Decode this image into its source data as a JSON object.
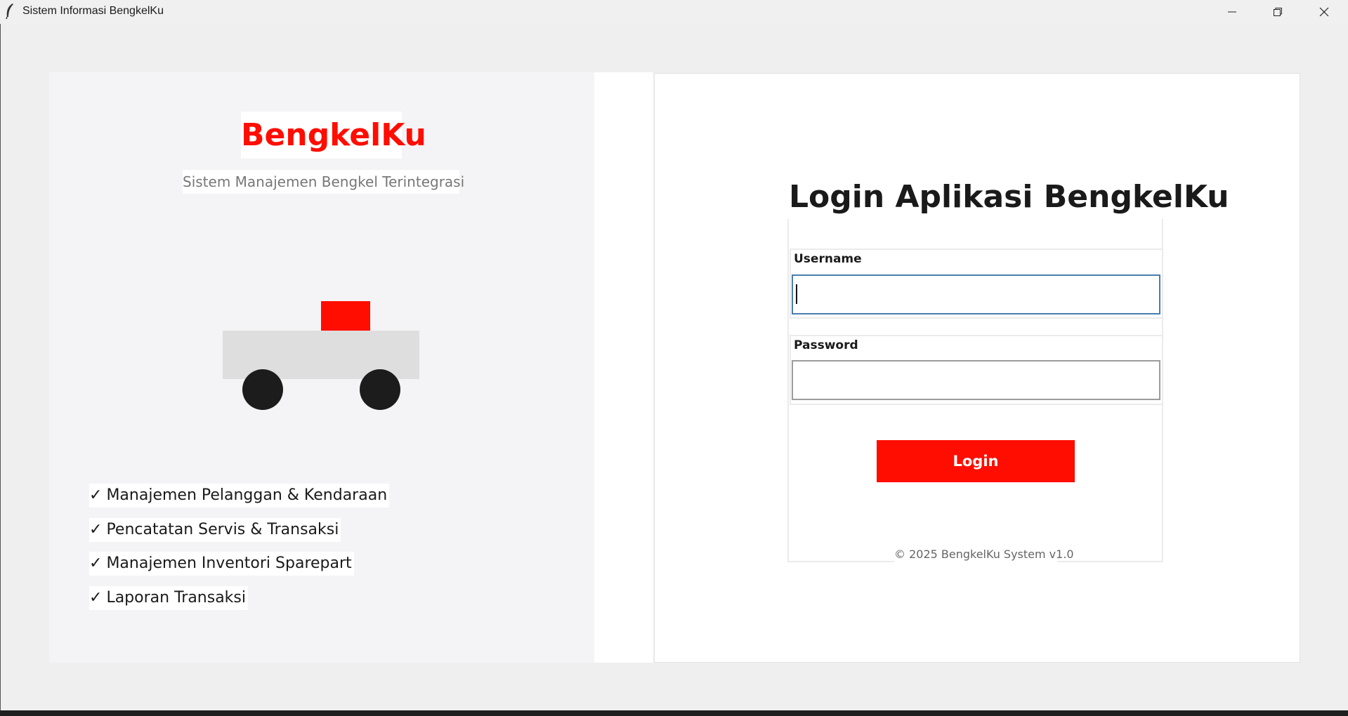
{
  "window": {
    "title": "Sistem Informasi BengkelKu",
    "icon": "feather-icon",
    "controls": [
      "minimize-icon",
      "restore-icon",
      "close-icon"
    ]
  },
  "brand": {
    "name": "BengkelKu",
    "tagline": "Sistem Manajemen Bengkel Terintegrasi",
    "color": "#ff0d00"
  },
  "features": [
    {
      "check": "✓",
      "text": "Manajemen Pelanggan & Kendaraan"
    },
    {
      "check": "✓",
      "text": "Pencatatan Servis & Transaksi"
    },
    {
      "check": "✓",
      "text": "Manajemen Inventori Sparepart"
    },
    {
      "check": "✓",
      "text": "Laporan Transaksi"
    }
  ],
  "login": {
    "title": "Login Aplikasi BengkelKu",
    "username_label": "Username",
    "username_value": "",
    "password_label": "Password",
    "password_value": "",
    "button_label": "Login",
    "footer": "© 2025 BengkelKu System v1.0"
  }
}
